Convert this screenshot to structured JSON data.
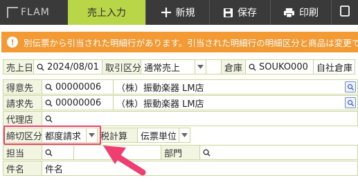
{
  "toolbar": {
    "logo_text": "FLAM",
    "active_tab": "売上入力",
    "new_label": "新規",
    "save_label": "保存",
    "print_label": "印刷"
  },
  "warning": {
    "icon": "!",
    "text": "別伝票から引当された明細行があります。引当された明細行の明細区分と商品は変更でき"
  },
  "header_row": {
    "date_label": "売上日",
    "date_value": "2024/08/01",
    "trade_label": "取引区分",
    "trade_value": "通常売上",
    "warehouse_label": "倉庫",
    "warehouse_code": "SOUKO000",
    "warehouse_name": "自社倉庫"
  },
  "customer": {
    "label": "得意先",
    "code": "00000006",
    "name": "（株）振動楽器 LM店"
  },
  "billing": {
    "label": "請求先",
    "code": "00000006",
    "name": "（株）振動楽器 LM店"
  },
  "agent": {
    "label": "代理店"
  },
  "closing": {
    "label": "締切区分",
    "value": "都度請求",
    "tax_label": "税計算",
    "tax_value": "伝票単位"
  },
  "staff": {
    "label": "担当",
    "dept_label": "部門"
  },
  "subject": {
    "label": "件名",
    "value": "件名"
  },
  "colors": {
    "toolbar_bg": "#3a3a3a",
    "active_tab": "#b9d548",
    "warning": "#f39a34",
    "highlight": "#ef3e72"
  }
}
